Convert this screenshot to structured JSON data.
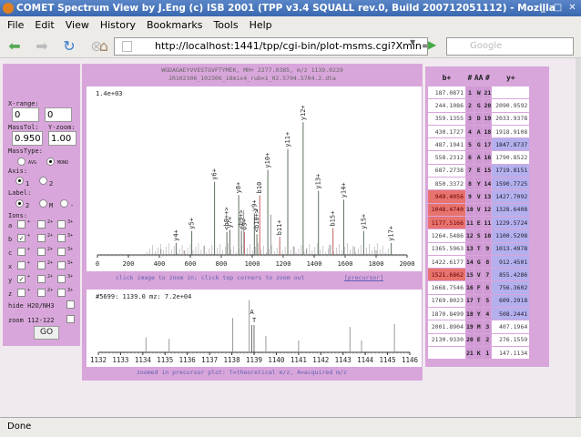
{
  "window": {
    "title": "COMET Spectrum View by J.Eng (c) ISB 2001 (TPP v3.4 SQUALL rev.0, Build 200712051112) - Mozilla Firefox"
  },
  "menu": [
    "File",
    "Edit",
    "View",
    "History",
    "Bookmarks",
    "Tools",
    "Help"
  ],
  "toolbar": {
    "url": "http://localhost:1441/tpp/cgi-bin/plot-msms.cgi?Xmin=0&Xr",
    "search_placeholder": "Google"
  },
  "status": "Done",
  "controls": {
    "xrange_label": "X-range:",
    "xmin": "0",
    "xmax": "0",
    "masstol_label": "MassTol:",
    "masstol": "0.950",
    "yzoom_label": "Y-zoom:",
    "yzoom": "1.00",
    "masstype_label": "MassType:",
    "masstype_options": [
      "AVG",
      "MONO"
    ],
    "masstype_selected": "MONO",
    "axis_label": "Axis:",
    "axis_options": [
      "1",
      "2"
    ],
    "axis_selected": "1",
    "label_label": "Label:",
    "label_options": [
      "2",
      "M",
      "-"
    ],
    "label_selected": "2",
    "ions_label": "Ions:",
    "ions": [
      {
        "name": "a",
        "charges": [
          "+",
          "2+",
          "3+"
        ],
        "checked": [
          false,
          false,
          false
        ]
      },
      {
        "name": "b",
        "charges": [
          "+",
          "2+",
          "3+"
        ],
        "checked": [
          true,
          false,
          false
        ]
      },
      {
        "name": "c",
        "charges": [
          "+",
          "2+",
          "3+"
        ],
        "checked": [
          false,
          false,
          false
        ]
      },
      {
        "name": "x",
        "charges": [
          "+",
          "2+",
          "3+"
        ],
        "checked": [
          false,
          false,
          false
        ]
      },
      {
        "name": "y",
        "charges": [
          "+",
          "2+",
          "3+"
        ],
        "checked": [
          true,
          false,
          false
        ]
      },
      {
        "name": "z",
        "charges": [
          "+",
          "2+",
          "3+"
        ],
        "checked": [
          false,
          false,
          false
        ]
      }
    ],
    "hide_label": "hide H2O/NH3",
    "zoom_label": "zoom 112-122",
    "go": "GO"
  },
  "spectrum": {
    "header1": "WGDAGAEYVVESTGVFTYMEK, MH+ 2277.0385, m/z 1139.0229",
    "header2": "JR102306_102306_18mix4_rub=1_02.5704.5704.2.dta",
    "hint": "click image to zoom in; click top corners to zoom out",
    "precursor_link": "[precursor]",
    "zoom_note": "zoomed in precursor plot: T=theoretical m/z, A=acquired m/z"
  },
  "chart_data": [
    {
      "type": "bar",
      "title": "",
      "max_label": "1.4e+03",
      "xlim": [
        0,
        2000
      ],
      "ylim": [
        0,
        1400
      ],
      "xticks": [
        0,
        200,
        400,
        600,
        800,
        1000,
        1200,
        1400,
        1600,
        1800,
        2000
      ],
      "colors": {
        "matched": "#607060",
        "labeled_b": "#c06060",
        "noise": "#888888"
      },
      "peaks": [
        {
          "mz": 508.2,
          "i": 104,
          "label": "y4+"
        },
        {
          "mz": 609.3,
          "i": 208,
          "label": "y5+"
        },
        {
          "mz": 756.4,
          "i": 635,
          "label": "y6+"
        },
        {
          "mz": 855.4,
          "i": 218,
          "label": "y7+"
        },
        {
          "mz": 836,
          "i": 200,
          "label": "<b9++>"
        },
        {
          "mz": 912.5,
          "i": 519,
          "label": "y8+"
        },
        {
          "mz": 930,
          "i": 210,
          "label": "<b9+>"
        },
        {
          "mz": 949.4,
          "i": 200,
          "label": "b9+"
        },
        {
          "mz": 945,
          "i": 389,
          "label": ""
        },
        {
          "mz": 1013.7,
          "i": 363,
          "label": "y9+"
        },
        {
          "mz": 1030,
          "i": 180,
          "label": "<b10+>"
        },
        {
          "mz": 1048.5,
          "i": 519,
          "label": "b10"
        },
        {
          "mz": 1100.5,
          "i": 739,
          "label": "y10+"
        },
        {
          "mz": 1120,
          "i": 350,
          "label": ""
        },
        {
          "mz": 1177.5,
          "i": 156,
          "label": "b11+"
        },
        {
          "mz": 1229.6,
          "i": 920,
          "label": "y11+"
        },
        {
          "mz": 1328.7,
          "i": 1153,
          "label": "y12+"
        },
        {
          "mz": 1427.7,
          "i": 557,
          "label": "y13+"
        },
        {
          "mz": 1521.7,
          "i": 233,
          "label": "b15+"
        },
        {
          "mz": 1590.8,
          "i": 480,
          "label": "y14+"
        },
        {
          "mz": 1719.8,
          "i": 208,
          "label": "y15+"
        },
        {
          "mz": 1897.9,
          "i": 104,
          "label": "y17+"
        },
        {
          "mz": 410,
          "i": 50,
          "label": ""
        },
        {
          "mz": 690,
          "i": 80,
          "label": ""
        },
        {
          "mz": 1270,
          "i": 70,
          "label": ""
        },
        {
          "mz": 1500,
          "i": 90,
          "label": ""
        },
        {
          "mz": 1660,
          "i": 70,
          "label": ""
        },
        {
          "mz": 1350,
          "i": 50,
          "label": ""
        },
        {
          "mz": 560,
          "i": 40,
          "label": ""
        },
        {
          "mz": 1800,
          "i": 40,
          "label": ""
        }
      ]
    },
    {
      "type": "bar",
      "title": "",
      "max_label": "#5699: 1139.0 mz: 7.2e+04",
      "xlim": [
        1132,
        1146
      ],
      "ylim": [
        0,
        72000
      ],
      "xticks": [
        1132,
        1133,
        1134,
        1135,
        1136,
        1137,
        1138,
        1139,
        1140,
        1141,
        1142,
        1143,
        1144,
        1145,
        1146
      ],
      "markers": [
        {
          "mz": 1138.9,
          "label": "A"
        },
        {
          "mz": 1139.0,
          "label": "T"
        }
      ],
      "peaks": [
        {
          "mz": 1134.14,
          "i": 20000
        },
        {
          "mz": 1135.18,
          "i": 18000
        },
        {
          "mz": 1138.04,
          "i": 46000
        },
        {
          "mz": 1138.78,
          "i": 70000
        },
        {
          "mz": 1139.53,
          "i": 22000
        },
        {
          "mz": 1141.0,
          "i": 16000
        },
        {
          "mz": 1143.31,
          "i": 34000
        },
        {
          "mz": 1143.83,
          "i": 16000
        },
        {
          "mz": 1145.31,
          "i": 38000
        }
      ]
    }
  ],
  "fragments": {
    "headers": [
      "b+",
      "#",
      "AA",
      "#",
      "y+"
    ],
    "rows": [
      {
        "b": "187.0871",
        "n": "1",
        "aa": "W",
        "m": "21",
        "y": "",
        "hb": false,
        "hy": false
      },
      {
        "b": "244.1086",
        "n": "2",
        "aa": "G",
        "m": "20",
        "y": "2090.9592",
        "hb": false,
        "hy": false
      },
      {
        "b": "359.1355",
        "n": "3",
        "aa": "D",
        "m": "19",
        "y": "2033.9378",
        "hb": false,
        "hy": false
      },
      {
        "b": "430.1727",
        "n": "4",
        "aa": "A",
        "m": "18",
        "y": "1918.9108",
        "hb": false,
        "hy": false
      },
      {
        "b": "487.1941",
        "n": "5",
        "aa": "G",
        "m": "17",
        "y": "1847.8737",
        "hb": false,
        "hy": true
      },
      {
        "b": "558.2312",
        "n": "6",
        "aa": "A",
        "m": "16",
        "y": "1790.8522",
        "hb": false,
        "hy": false
      },
      {
        "b": "687.2738",
        "n": "7",
        "aa": "E",
        "m": "15",
        "y": "1719.8151",
        "hb": false,
        "hy": true
      },
      {
        "b": "850.3372",
        "n": "8",
        "aa": "Y",
        "m": "14",
        "y": "1590.7725",
        "hb": false,
        "hy": true
      },
      {
        "b": "949.4056",
        "n": "9",
        "aa": "V",
        "m": "13",
        "y": "1427.7092",
        "hb": true,
        "hy": true
      },
      {
        "b": "1048.4740",
        "n": "10",
        "aa": "V",
        "m": "12",
        "y": "1328.6408",
        "hb": true,
        "hy": true
      },
      {
        "b": "1177.5166",
        "n": "11",
        "aa": "E",
        "m": "11",
        "y": "1229.5724",
        "hb": true,
        "hy": true
      },
      {
        "b": "1264.5486",
        "n": "12",
        "aa": "S",
        "m": "10",
        "y": "1100.5298",
        "hb": false,
        "hy": true
      },
      {
        "b": "1365.5963",
        "n": "13",
        "aa": "T",
        "m": "9",
        "y": "1013.4978",
        "hb": false,
        "hy": true
      },
      {
        "b": "1422.6177",
        "n": "14",
        "aa": "G",
        "m": "8",
        "y": "912.4501",
        "hb": false,
        "hy": true
      },
      {
        "b": "1521.6862",
        "n": "15",
        "aa": "V",
        "m": "7",
        "y": "855.4286",
        "hb": true,
        "hy": true
      },
      {
        "b": "1668.7546",
        "n": "16",
        "aa": "F",
        "m": "6",
        "y": "756.3602",
        "hb": false,
        "hy": true
      },
      {
        "b": "1769.8023",
        "n": "17",
        "aa": "T",
        "m": "5",
        "y": "609.2918",
        "hb": false,
        "hy": true
      },
      {
        "b": "1870.8499",
        "n": "18",
        "aa": "Y",
        "m": "4",
        "y": "508.2441",
        "hb": false,
        "hy": true
      },
      {
        "b": "2001.8904",
        "n": "19",
        "aa": "M",
        "m": "3",
        "y": "407.1964",
        "hb": false,
        "hy": false
      },
      {
        "b": "2130.9330",
        "n": "20",
        "aa": "E",
        "m": "2",
        "y": "276.1559",
        "hb": false,
        "hy": false
      },
      {
        "b": "",
        "n": "21",
        "aa": "K",
        "m": "1",
        "y": "147.1134",
        "hb": false,
        "hy": false
      }
    ]
  }
}
